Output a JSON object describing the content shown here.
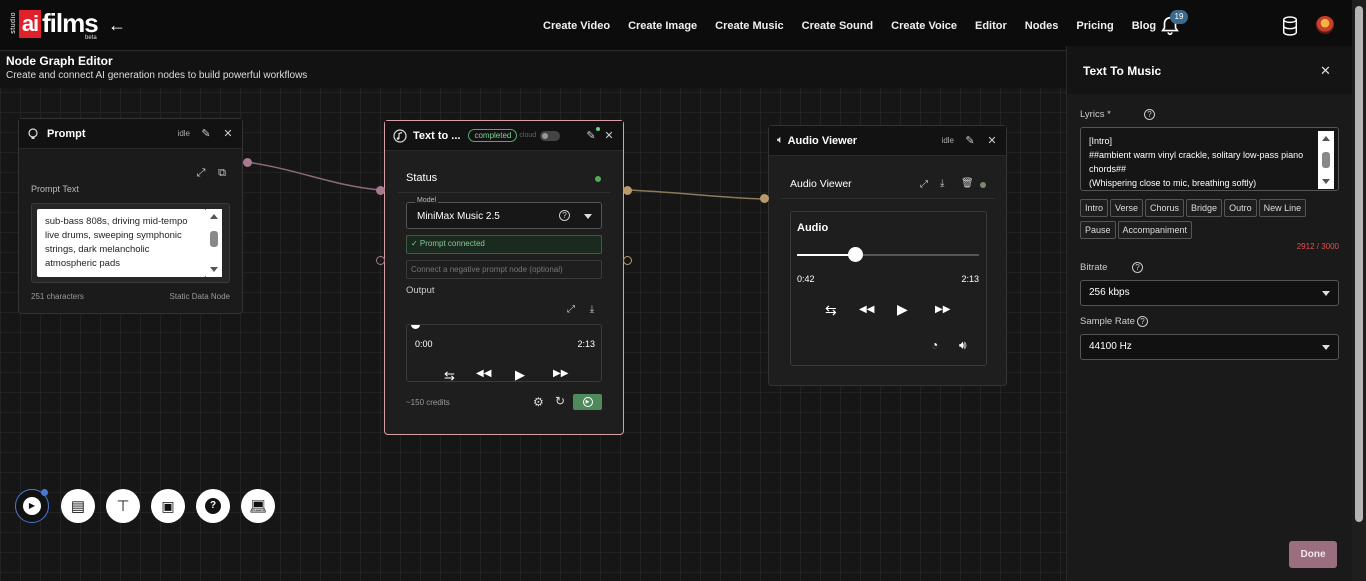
{
  "app": {
    "logo": {
      "studio": "studio",
      "ai": "ai",
      "films": "films",
      "beta": "beta"
    },
    "nav": [
      "Create Video",
      "Create Image",
      "Create Music",
      "Create Sound",
      "Create Voice",
      "Editor",
      "Nodes",
      "Pricing",
      "Blog"
    ],
    "notifications_count": "19"
  },
  "page": {
    "title": "Node Graph Editor",
    "subtitle": "Create and connect AI generation nodes to build powerful workflows"
  },
  "prompt_node": {
    "title": "Prompt",
    "status": "idle",
    "field_label": "Prompt Text",
    "text": "sub-bass 808s, driving mid-tempo live drums, sweeping symphonic strings, dark melancholic atmospheric pads",
    "char_count": "251 characters",
    "node_type": "Static Data Node"
  },
  "music_node": {
    "title": "Text to ...",
    "badge": "completed",
    "cloud_label": "cloud",
    "status_label": "Status",
    "model_label": "Model",
    "model_value": "MiniMax Music 2.5",
    "prompt_connected": "✓ Prompt connected",
    "negative_placeholder": "Connect a negative prompt node (optional)",
    "output_label": "Output",
    "time_current": "0:00",
    "time_total": "2:13",
    "credits": "~150 credits"
  },
  "audio_node": {
    "title": "Audio Viewer",
    "status": "idle",
    "inner_title": "Audio Viewer",
    "audio_label": "Audio",
    "time_current": "0:42",
    "time_total": "2:13",
    "progress": 0.32
  },
  "panel": {
    "title": "Text To Music",
    "lyrics_label": "Lyrics *",
    "lyrics_lines": [
      "[Intro]",
      "##ambient warm vinyl crackle, solitary low-pass piano chords##",
      "(Whispering close to mic, breathing softly)"
    ],
    "chips": [
      "Intro",
      "Verse",
      "Chorus",
      "Bridge",
      "Outro",
      "New Line",
      "Pause",
      "Accompaniment"
    ],
    "counter": "2912 / 3000",
    "bitrate_label": "Bitrate",
    "bitrate_value": "256 kbps",
    "sample_rate_label": "Sample Rate",
    "sample_rate_value": "44100 Hz",
    "done": "Done"
  },
  "colors": {
    "accent_red": "#e0202a",
    "done_button": "#9a6e7e",
    "counter": "#e05050",
    "status_green": "#4caf50"
  }
}
